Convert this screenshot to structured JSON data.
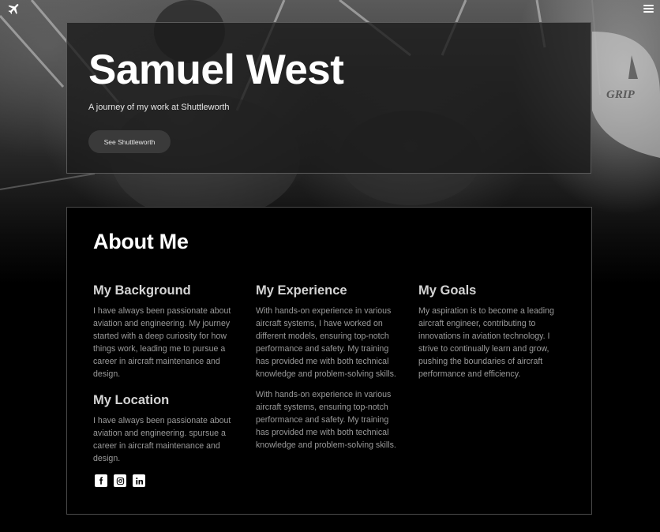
{
  "hero": {
    "name": "Samuel West",
    "subtitle": "A journey of my work at Shuttleworth",
    "cta_label": "See Shuttleworth"
  },
  "about": {
    "title": "About Me",
    "background": {
      "heading": "My Background",
      "text": "I have always been passionate about aviation and engineering. My journey started with a deep curiosity for how things work, leading me to pursue a career in aircraft maintenance and design."
    },
    "location": {
      "heading": "My Location",
      "text": "I have always been passionate about aviation and engineering. spursue a career in aircraft maintenance and design."
    },
    "experience": {
      "heading": "My Experience",
      "text1": "With hands-on experience in various aircraft systems, I have worked on different models, ensuring top-notch performance and safety. My training has provided me with both technical knowledge and problem-solving skills.",
      "text2": "With hands-on experience in various aircraft systems, ensuring top-notch performance and safety. My training has provided me with both technical knowledge and problem-solving skills."
    },
    "goals": {
      "heading": "My Goals",
      "text": "My aspiration is to become a leading aircraft engineer, contributing to innovations in aviation technology. I strive to continually learn and grow, pushing the boundaries of aircraft performance and efficiency."
    },
    "social": [
      "facebook-icon",
      "instagram-icon",
      "linkedin-icon"
    ]
  },
  "background_text": "GRIP",
  "colors": {
    "page_bg": "#000000",
    "hero_card_bg": "#191919",
    "button_bg": "#3a3a3a",
    "body_text": "#9a9a9a",
    "heading_text": "#d4d4d4"
  }
}
